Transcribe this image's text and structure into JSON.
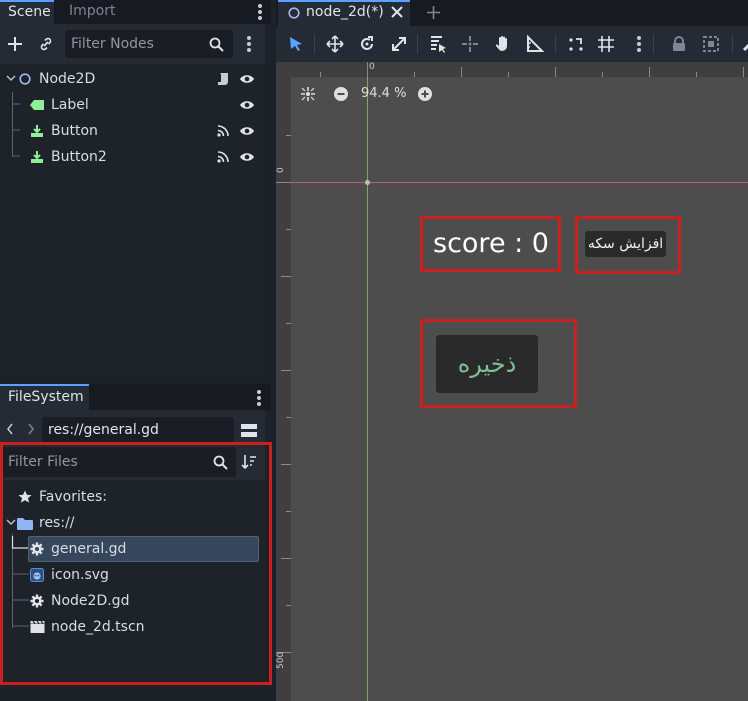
{
  "scene_dock": {
    "tabs": [
      {
        "label": "Scene",
        "active": true
      },
      {
        "label": "Import",
        "active": false
      }
    ],
    "filter_placeholder": "Filter Nodes",
    "nodes": [
      {
        "label": "Node2D",
        "icon": "node2d-icon",
        "depth": 0
      },
      {
        "label": "Label",
        "icon": "label-icon",
        "depth": 1
      },
      {
        "label": "Button",
        "icon": "button-icon",
        "depth": 1
      },
      {
        "label": "Button2",
        "icon": "button-icon",
        "depth": 1
      }
    ]
  },
  "filesystem_dock": {
    "tab": "FileSystem",
    "path": "res://general.gd",
    "filter_placeholder": "Filter Files",
    "favorites_label": "Favorites:",
    "root_label": "res://",
    "files": [
      {
        "name": "general.gd",
        "icon": "gear-icon",
        "selected": true
      },
      {
        "name": "icon.svg",
        "icon": "godot-icon",
        "selected": false
      },
      {
        "name": "Node2D.gd",
        "icon": "gear-icon",
        "selected": false
      },
      {
        "name": "node_2d.tscn",
        "icon": "scene-icon",
        "selected": false
      }
    ]
  },
  "editor": {
    "tab_title": "node_2d(*)",
    "zoom": "94.4 %",
    "ruler_top_zero": "0",
    "ruler_left_zero": "0",
    "ruler_left_500": "500"
  },
  "game": {
    "score_label": "score : 0",
    "increase_button": "افزایش سکه",
    "save_button": "ذخیره"
  },
  "colors": {
    "accent": "#5aa2ff",
    "highlight_box": "#cc1f1f",
    "node_icon_green": "#8eef97",
    "viewport_bg": "#4d4d4d"
  }
}
